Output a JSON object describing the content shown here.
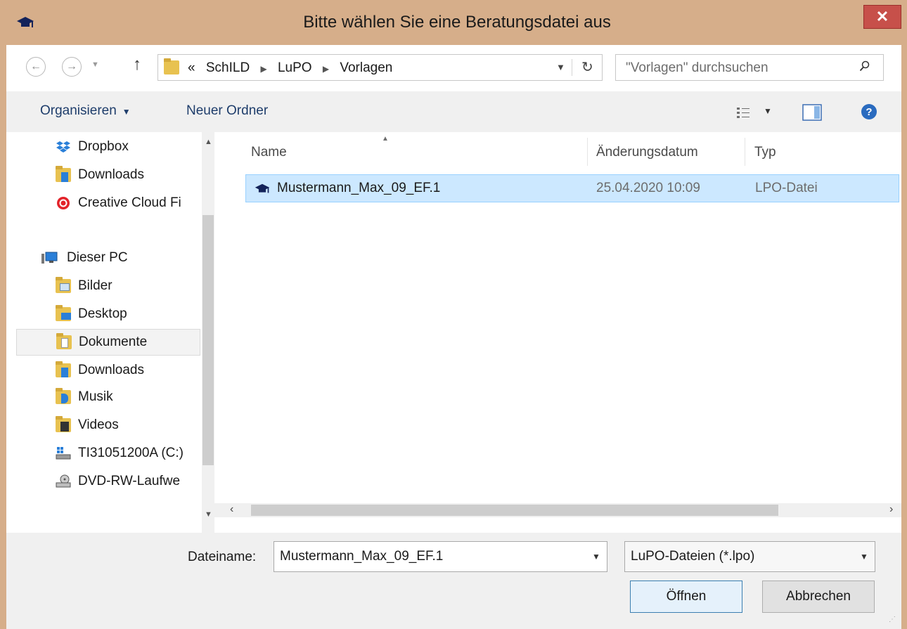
{
  "window": {
    "title": "Bitte wählen Sie eine Beratungsdatei aus",
    "close_label": "✕"
  },
  "address": {
    "crumb_prefix": "«",
    "crumbs": [
      "SchILD",
      "LuPO",
      "Vorlagen"
    ],
    "search_placeholder": "\"Vorlagen\" durchsuchen"
  },
  "toolbar": {
    "organize_label": "Organisieren",
    "new_folder_label": "Neuer Ordner"
  },
  "sidebar": {
    "items": [
      {
        "label": "Dropbox",
        "icon": "dropbox-icon"
      },
      {
        "label": "Downloads",
        "icon": "downloads-folder-icon"
      },
      {
        "label": "Creative Cloud Fi",
        "icon": "creative-cloud-icon"
      },
      {
        "label": "Dieser PC",
        "icon": "computer-icon"
      },
      {
        "label": "Bilder",
        "icon": "pictures-folder-icon"
      },
      {
        "label": "Desktop",
        "icon": "desktop-folder-icon"
      },
      {
        "label": "Dokumente",
        "icon": "documents-folder-icon",
        "selected": true
      },
      {
        "label": "Downloads",
        "icon": "downloads-folder-icon"
      },
      {
        "label": "Musik",
        "icon": "music-folder-icon"
      },
      {
        "label": "Videos",
        "icon": "videos-folder-icon"
      },
      {
        "label": "TI31051200A (C:)",
        "icon": "drive-icon"
      },
      {
        "label": "DVD-RW-Laufwe",
        "icon": "dvd-drive-icon"
      }
    ]
  },
  "files": {
    "columns": [
      "Name",
      "Änderungsdatum",
      "Typ"
    ],
    "rows": [
      {
        "name": "Mustermann_Max_09_EF.1",
        "date": "25.04.2020 10:09",
        "type": "LPO-Datei",
        "selected": true
      }
    ]
  },
  "footer": {
    "filename_label": "Dateiname:",
    "filename_value": "Mustermann_Max_09_EF.1",
    "filetype_value": "LuPO-Dateien (*.lpo)",
    "open_label": "Öffnen",
    "cancel_label": "Abbrechen"
  },
  "colors": {
    "title_bar": "#d6ae8a",
    "selection": "#cce8ff",
    "close_button": "#c7504a"
  }
}
